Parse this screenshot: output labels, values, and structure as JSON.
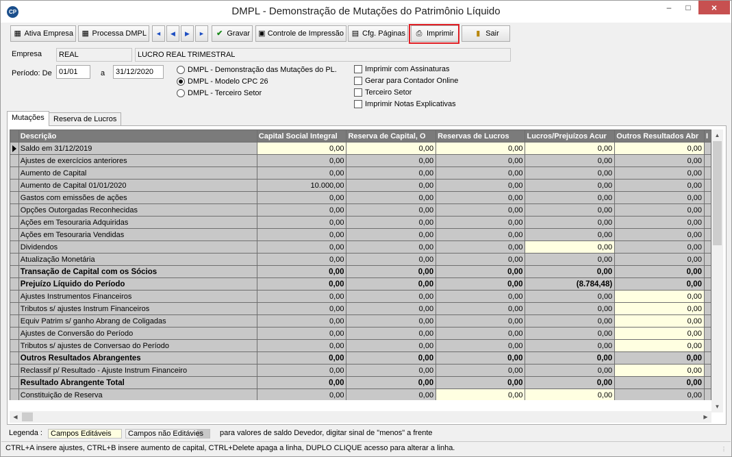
{
  "window": {
    "title": "DMPL - Demonstração de Mutações do Patrimônio Líquido",
    "logo": "CP"
  },
  "toolbar": {
    "ativa_empresa": "Ativa Empresa",
    "processa_dmpl": "Processa DMPL",
    "gravar": "Gravar",
    "controle_impressao": "Controle de Impressão",
    "cfg_paginas": "Cfg. Páginas",
    "imprimir": "Imprimir",
    "sair": "Sair"
  },
  "form": {
    "empresa_label": "Empresa",
    "empresa_code": "REAL",
    "empresa_name": "LUCRO REAL TRIMESTRAL",
    "periodo_label": "Período: De",
    "periodo_de": "01/01",
    "periodo_a_label": "a",
    "periodo_ate": "31/12/2020",
    "radio": [
      {
        "label": "DMPL - Demonstração das Mutações do PL.",
        "selected": false
      },
      {
        "label": "DMPL - Modelo CPC 26",
        "selected": true
      },
      {
        "label": "DMPL - Terceiro Setor",
        "selected": false
      }
    ],
    "checks": [
      {
        "label": "Imprimir com Assinaturas",
        "checked": false
      },
      {
        "label": "Gerar para Contador Online",
        "checked": false
      },
      {
        "label": "Terceiro Setor",
        "checked": false
      },
      {
        "label": "Imprimir Notas Explicativas",
        "checked": false
      }
    ]
  },
  "tabs": {
    "mutacoes": "Mutações",
    "reserva": "Reserva de Lucros"
  },
  "grid": {
    "headers": [
      "Descrição",
      "Capital Social Integral",
      "Reserva de Capital, O",
      "Reservas de Lucros",
      "Lucros/Prejuízos Acur",
      "Outros Resultados Abr",
      "I"
    ],
    "rows": [
      {
        "desc": "Saldo em 31/12/2019",
        "bold": false,
        "current": true,
        "values": [
          "0,00",
          "0,00",
          "0,00",
          "0,00",
          "0,00"
        ],
        "editable": [
          true,
          true,
          true,
          true,
          true
        ]
      },
      {
        "desc": "Ajustes de exercícios anteriores",
        "bold": false,
        "values": [
          "0,00",
          "0,00",
          "0,00",
          "0,00",
          "0,00"
        ],
        "editable": [
          false,
          false,
          false,
          false,
          false
        ]
      },
      {
        "desc": "Aumento de Capital",
        "bold": false,
        "values": [
          "0,00",
          "0,00",
          "0,00",
          "0,00",
          "0,00"
        ],
        "editable": [
          false,
          false,
          false,
          false,
          false
        ]
      },
      {
        "desc": "Aumento de Capital 01/01/2020",
        "bold": false,
        "values": [
          "10.000,00",
          "0,00",
          "0,00",
          "0,00",
          "0,00"
        ],
        "editable": [
          false,
          false,
          false,
          false,
          false
        ]
      },
      {
        "desc": "Gastos com emissões de ações",
        "bold": false,
        "values": [
          "0,00",
          "0,00",
          "0,00",
          "0,00",
          "0,00"
        ],
        "editable": [
          false,
          false,
          false,
          false,
          false
        ]
      },
      {
        "desc": "Opções Outorgadas Reconhecidas",
        "bold": false,
        "values": [
          "0,00",
          "0,00",
          "0,00",
          "0,00",
          "0,00"
        ],
        "editable": [
          false,
          false,
          false,
          false,
          false
        ]
      },
      {
        "desc": "Ações em Tesouraria Adquiridas",
        "bold": false,
        "values": [
          "0,00",
          "0,00",
          "0,00",
          "0,00",
          "0,00"
        ],
        "editable": [
          false,
          false,
          false,
          false,
          false
        ]
      },
      {
        "desc": "Ações em Tesouraria Vendidas",
        "bold": false,
        "values": [
          "0,00",
          "0,00",
          "0,00",
          "0,00",
          "0,00"
        ],
        "editable": [
          false,
          false,
          false,
          false,
          false
        ]
      },
      {
        "desc": "Dividendos",
        "bold": false,
        "values": [
          "0,00",
          "0,00",
          "0,00",
          "0,00",
          "0,00"
        ],
        "editable": [
          false,
          false,
          false,
          true,
          false
        ]
      },
      {
        "desc": "Atualização Monetária",
        "bold": false,
        "values": [
          "0,00",
          "0,00",
          "0,00",
          "0,00",
          "0,00"
        ],
        "editable": [
          false,
          false,
          false,
          false,
          false
        ]
      },
      {
        "desc": "Transação de Capital com os Sócios",
        "bold": true,
        "values": [
          "0,00",
          "0,00",
          "0,00",
          "0,00",
          "0,00"
        ],
        "editable": [
          false,
          false,
          false,
          false,
          false
        ]
      },
      {
        "desc": "Prejuízo Líquido do Período",
        "bold": true,
        "values": [
          "0,00",
          "0,00",
          "0,00",
          "(8.784,48)",
          "0,00"
        ],
        "editable": [
          false,
          false,
          false,
          false,
          false
        ]
      },
      {
        "desc": "Ajustes Instrumentos Financeiros",
        "bold": false,
        "values": [
          "0,00",
          "0,00",
          "0,00",
          "0,00",
          "0,00"
        ],
        "editable": [
          false,
          false,
          false,
          false,
          true
        ]
      },
      {
        "desc": "Tributos s/ ajustes Instrum Financeiros",
        "bold": false,
        "values": [
          "0,00",
          "0,00",
          "0,00",
          "0,00",
          "0,00"
        ],
        "editable": [
          false,
          false,
          false,
          false,
          true
        ]
      },
      {
        "desc": "Equiv Patrim s/ ganho Abrang de Coligadas",
        "bold": false,
        "values": [
          "0,00",
          "0,00",
          "0,00",
          "0,00",
          "0,00"
        ],
        "editable": [
          false,
          false,
          false,
          false,
          true
        ]
      },
      {
        "desc": "Ajustes de Conversão do Período",
        "bold": false,
        "values": [
          "0,00",
          "0,00",
          "0,00",
          "0,00",
          "0,00"
        ],
        "editable": [
          false,
          false,
          false,
          false,
          true
        ]
      },
      {
        "desc": "Tributos s/ ajustes de Conversao do Período",
        "bold": false,
        "values": [
          "0,00",
          "0,00",
          "0,00",
          "0,00",
          "0,00"
        ],
        "editable": [
          false,
          false,
          false,
          false,
          true
        ]
      },
      {
        "desc": "Outros Resultados Abrangentes",
        "bold": true,
        "values": [
          "0,00",
          "0,00",
          "0,00",
          "0,00",
          "0,00"
        ],
        "editable": [
          false,
          false,
          false,
          false,
          false
        ]
      },
      {
        "desc": "Reclassif p/ Resultado - Ajuste Instrum Financeiro",
        "bold": false,
        "values": [
          "0,00",
          "0,00",
          "0,00",
          "0,00",
          "0,00"
        ],
        "editable": [
          false,
          false,
          false,
          false,
          true
        ]
      },
      {
        "desc": "Resultado Abrangente Total",
        "bold": true,
        "values": [
          "0,00",
          "0,00",
          "0,00",
          "0,00",
          "0,00"
        ],
        "editable": [
          false,
          false,
          false,
          false,
          false
        ]
      },
      {
        "desc": "Constituição de Reserva",
        "bold": false,
        "values": [
          "0,00",
          "0,00",
          "0,00",
          "0,00",
          "0,00"
        ],
        "editable": [
          false,
          false,
          true,
          true,
          false
        ]
      }
    ]
  },
  "legend": {
    "label": "Legenda :",
    "editaveis": "Campos Editáveis",
    "nao_editaveis": "Campos não Editávies",
    "note": "para valores de saldo Devedor, digitar sinal de \"menos\" a frente"
  },
  "status": {
    "text": "CTRL+A insere ajustes, CTRL+B insere aumento de capital, CTRL+Delete apaga a linha, DUPLO CLIQUE acesso para alterar a linha."
  },
  "colors": {
    "editable": "#ffffe1",
    "readonly": "#c8c8c8",
    "header": "#7b7b7b",
    "highlight": "#e01e24"
  },
  "icons": [
    "app-logo-icon",
    "building-icon",
    "calculator-icon",
    "first-record-icon",
    "prior-record-icon",
    "next-record-icon",
    "last-record-icon",
    "checkmark-icon",
    "monitor-icon",
    "page-setup-icon",
    "printer-icon",
    "exit-door-icon"
  ]
}
